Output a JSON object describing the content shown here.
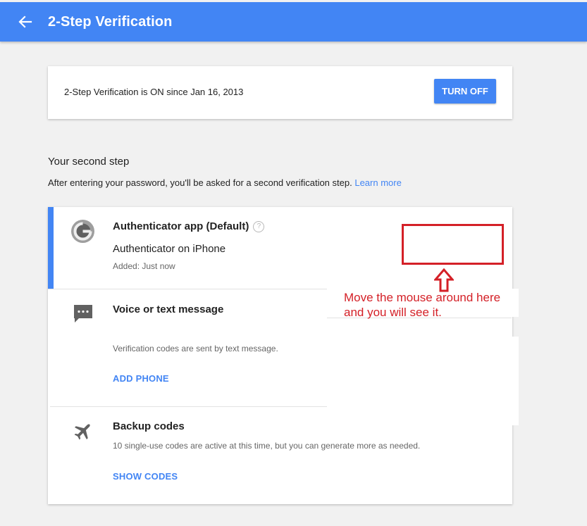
{
  "header": {
    "title": "2-Step Verification",
    "back_icon": "arrow-back-icon",
    "color": "#4285f4"
  },
  "status": {
    "text": "2-Step Verification is ON since Jan 16, 2013",
    "button_label": "TURN OFF"
  },
  "second_step": {
    "title": "Your second step",
    "description": "After entering your password, you'll be asked for a second verification step.",
    "learn_more": "Learn more"
  },
  "methods": [
    {
      "icon": "authenticator-icon",
      "title": "Authenticator app (Default)",
      "help_icon": "?",
      "subtitle": "Authenticator on iPhone",
      "detail": "Added: Just now"
    },
    {
      "icon": "message-icon",
      "title": "Voice or text message",
      "detail": "Verification codes are sent by text message.",
      "action": "ADD PHONE"
    },
    {
      "icon": "airplane-icon",
      "title": "Backup codes",
      "detail": "10 single-use codes are active at this time, but you can generate more as needed.",
      "action": "SHOW CODES"
    }
  ],
  "annotation": {
    "line1": "Move the mouse around here",
    "line2": "and you will see it.",
    "color": "#d42027"
  }
}
